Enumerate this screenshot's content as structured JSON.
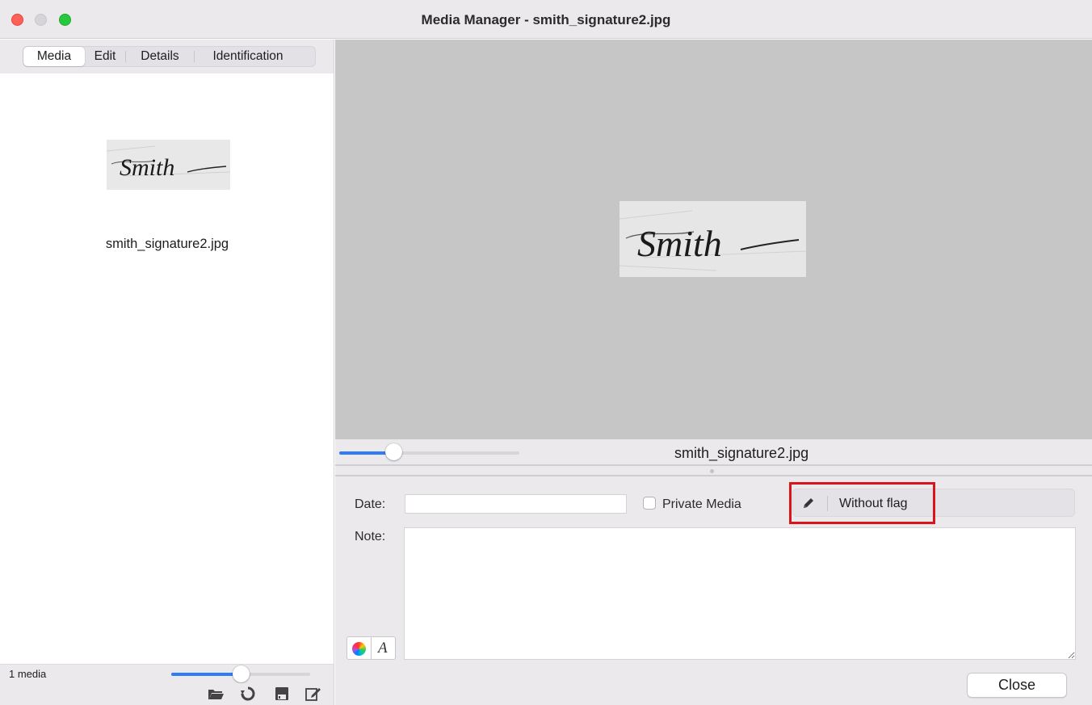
{
  "window": {
    "title": "Media Manager - smith_signature2.jpg"
  },
  "tabs": [
    {
      "label": "Media",
      "selected": true
    },
    {
      "label": "Edit",
      "selected": false
    },
    {
      "label": "Details",
      "selected": false
    },
    {
      "label": "Identification",
      "selected": false
    }
  ],
  "media_list": {
    "items": [
      {
        "filename": "smith_signature2.jpg",
        "signature_text": "Smith"
      }
    ],
    "count_label": "1 media",
    "thumbnail_size_level": 0.5
  },
  "preview": {
    "filename": "smith_signature2.jpg",
    "zoom_level": 0.3
  },
  "form": {
    "date_label": "Date:",
    "date_value": "",
    "private_label": "Private Media",
    "private_checked": false,
    "flag_label": "Without flag",
    "note_label": "Note:",
    "note_value": ""
  },
  "buttons": {
    "close": "Close"
  },
  "colors": {
    "accent": "#2f7cf6",
    "highlight": "#d9141a",
    "preview_background": "#c6c6c6"
  }
}
